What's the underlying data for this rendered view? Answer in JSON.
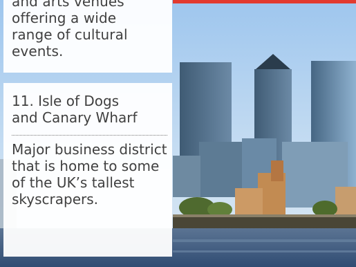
{
  "top_card": {
    "lines": [
      "and arts venues",
      "offering a wide",
      "range of cultural",
      "events."
    ]
  },
  "main_card": {
    "title_line1": "11. Isle of Dogs",
    "title_line2": "and Canary Wharf",
    "description": "Major business district that is home to some of the UK’s tallest skyscrapers."
  },
  "colors": {
    "sky": "#b9d8f4",
    "water": "#3d5f86",
    "accent_red": "#e23a2f"
  }
}
